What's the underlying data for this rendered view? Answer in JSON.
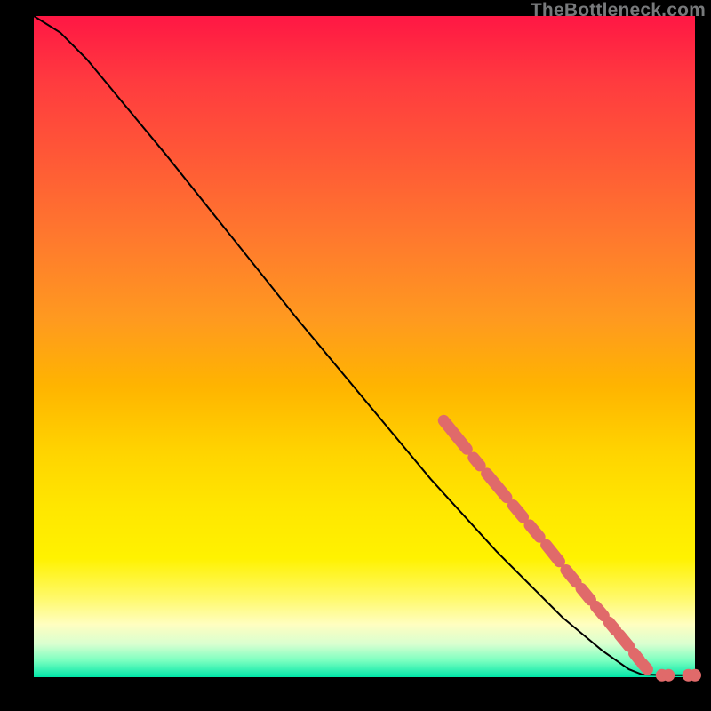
{
  "watermark": "TheBottleneck.com",
  "chart_data": {
    "type": "line",
    "title": "",
    "xlabel": "",
    "ylabel": "",
    "xlim": [
      0,
      100
    ],
    "ylim": [
      0,
      100
    ],
    "grid": false,
    "legend": false,
    "curve": [
      {
        "x": 0,
        "y": 100
      },
      {
        "x": 4,
        "y": 97.5
      },
      {
        "x": 8,
        "y": 93.5
      },
      {
        "x": 20,
        "y": 79
      },
      {
        "x": 40,
        "y": 54
      },
      {
        "x": 60,
        "y": 30
      },
      {
        "x": 70,
        "y": 19
      },
      {
        "x": 80,
        "y": 9
      },
      {
        "x": 86,
        "y": 4
      },
      {
        "x": 90,
        "y": 1.2
      },
      {
        "x": 92,
        "y": 0.4
      },
      {
        "x": 96,
        "y": 0.3
      },
      {
        "x": 100,
        "y": 0.3
      }
    ],
    "marker_segments": [
      {
        "x0": 62.0,
        "y0": 38.8,
        "x1": 65.5,
        "y1": 34.5
      },
      {
        "x0": 66.5,
        "y0": 33.2,
        "x1": 67.5,
        "y1": 32.0
      },
      {
        "x0": 68.5,
        "y0": 30.8,
        "x1": 71.5,
        "y1": 27.2
      },
      {
        "x0": 72.5,
        "y0": 26.0,
        "x1": 74.0,
        "y1": 24.2
      },
      {
        "x0": 75.0,
        "y0": 23.0,
        "x1": 76.5,
        "y1": 21.2
      },
      {
        "x0": 77.5,
        "y0": 20.0,
        "x1": 79.5,
        "y1": 17.5
      },
      {
        "x0": 80.5,
        "y0": 16.2,
        "x1": 82.0,
        "y1": 14.4
      },
      {
        "x0": 82.8,
        "y0": 13.4,
        "x1": 84.2,
        "y1": 11.7
      },
      {
        "x0": 85.0,
        "y0": 10.7,
        "x1": 86.2,
        "y1": 9.3
      },
      {
        "x0": 87.0,
        "y0": 8.3,
        "x1": 88.0,
        "y1": 7.1
      },
      {
        "x0": 88.6,
        "y0": 6.4,
        "x1": 90.0,
        "y1": 4.7
      },
      {
        "x0": 90.8,
        "y0": 3.6,
        "x1": 91.6,
        "y1": 2.6
      },
      {
        "x0": 92.0,
        "y0": 2.1,
        "x1": 92.8,
        "y1": 1.2
      }
    ],
    "marker_dots": [
      {
        "x": 95.0,
        "y": 0.3
      },
      {
        "x": 96.0,
        "y": 0.3
      },
      {
        "x": 99.0,
        "y": 0.3
      },
      {
        "x": 100.0,
        "y": 0.3
      }
    ],
    "colors": {
      "curve": "#000000",
      "marker": "#e06a6a",
      "background_top": "#ff1744",
      "background_bottom": "#00e6a8"
    }
  }
}
